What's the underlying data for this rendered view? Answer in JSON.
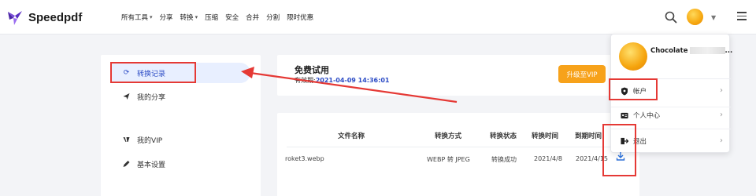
{
  "header": {
    "brand": "Speedpdf",
    "nav": [
      {
        "label": "所有工具",
        "dropdown": true
      },
      {
        "label": "分享",
        "dropdown": false
      },
      {
        "label": "转换",
        "dropdown": true
      },
      {
        "label": "压缩",
        "dropdown": false
      },
      {
        "label": "安全",
        "dropdown": false
      },
      {
        "label": "合并",
        "dropdown": false
      },
      {
        "label": "分割",
        "dropdown": false
      },
      {
        "label": "限时优惠",
        "dropdown": false
      }
    ]
  },
  "sidebar": {
    "items": [
      {
        "label": "转换记录",
        "icon": "refresh-icon",
        "active": true
      },
      {
        "label": "我的分享",
        "icon": "send-icon",
        "active": false
      },
      {
        "label": "我的VIP",
        "icon": "vip-icon",
        "active": false
      },
      {
        "label": "基本设置",
        "icon": "pencil-icon",
        "active": false
      }
    ]
  },
  "trial": {
    "title": "免费试用",
    "expiry_label": "有效期:",
    "expiry_value": "2021-04-09 14:36:01",
    "upgrade_label": "升级至VIP"
  },
  "table": {
    "headers": [
      "文件名称",
      "转换方式",
      "转换状态",
      "转换时间",
      "到期时间"
    ],
    "rows": [
      [
        "roket3.webp",
        "WEBP 转 JPEG",
        "转换成功",
        "2021/4/8",
        "2021/4/15"
      ]
    ]
  },
  "dropdown": {
    "username": "Chocolate",
    "name_suffix": "...",
    "items": [
      {
        "label": "帐户",
        "icon": "shield-icon"
      },
      {
        "label": "个人中心",
        "icon": "id-card-icon"
      },
      {
        "label": "退出",
        "icon": "logout-icon"
      }
    ]
  },
  "colors": {
    "accent_blue": "#2b4bc5",
    "upgrade_orange": "#f7a21a",
    "annotation_red": "#e53935",
    "active_bg": "#e8efff"
  }
}
